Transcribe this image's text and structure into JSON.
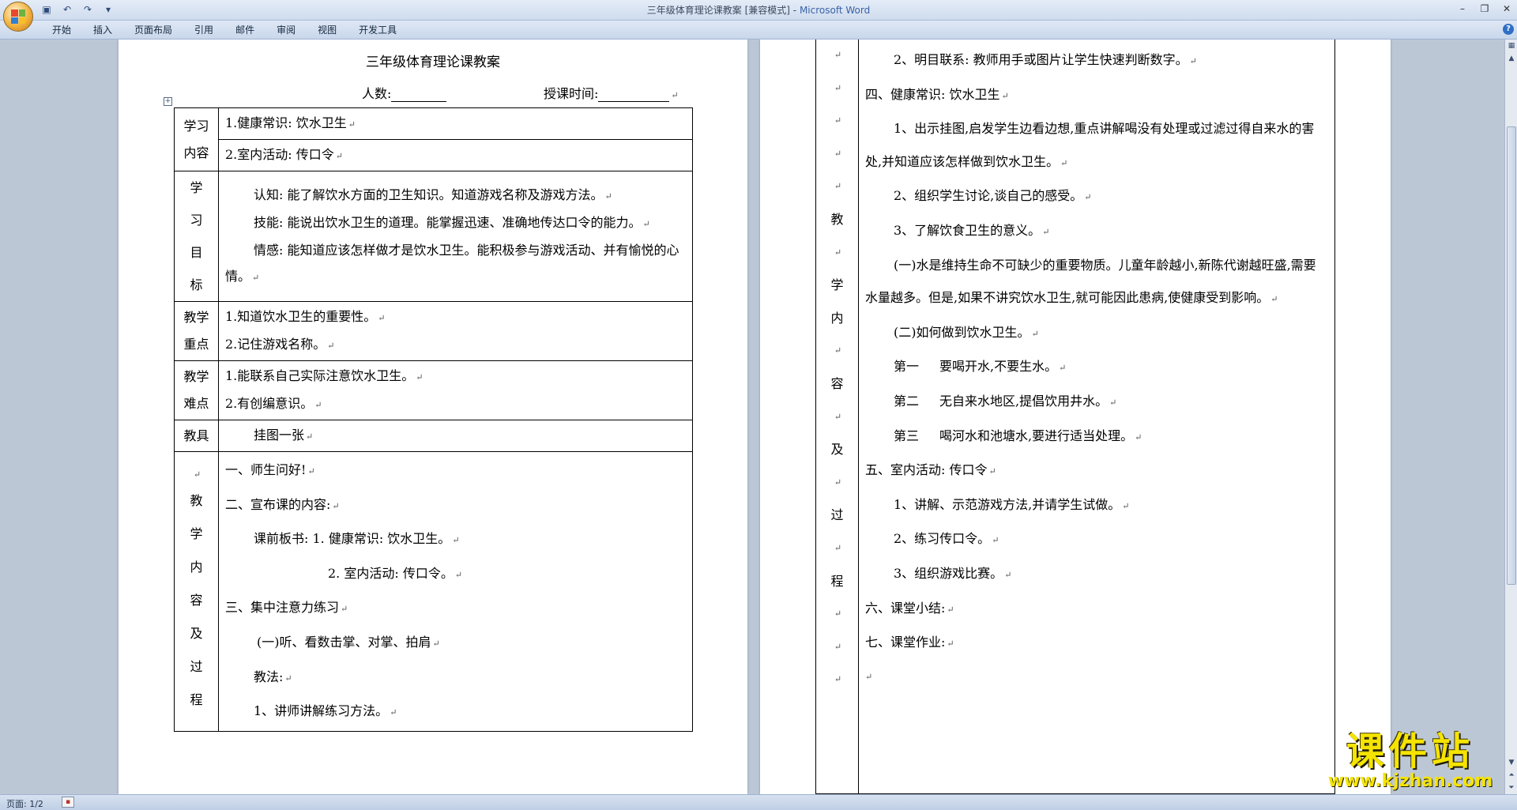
{
  "window": {
    "title": "三年级体育理论课教案 [兼容模式]",
    "app_name": "Microsoft Word"
  },
  "quick_access": [
    "save-icon",
    "undo-icon",
    "redo-icon",
    "customize-icon"
  ],
  "ribbon": {
    "tabs": [
      "开始",
      "插入",
      "页面布局",
      "引用",
      "邮件",
      "审阅",
      "视图",
      "开发工具"
    ]
  },
  "status": {
    "page": "页面: 1/2"
  },
  "watermark": {
    "text": "课件站",
    "url": "www.kjzhan.com"
  },
  "colors": {
    "accent": "#3a62a8",
    "watermark": "#f5e400"
  },
  "page1": {
    "title": "三年级体育理论课教案",
    "people_label": "人数:",
    "time_label": "授课时间:",
    "rows": {
      "content_head": "学习\n内容",
      "content_1": "1.健康常识: 饮水卫生",
      "content_2": "2.室内活动: 传口令",
      "goal_head": [
        "学",
        "习",
        "目",
        "标"
      ],
      "goal_1": "认知: 能了解饮水方面的卫生知识。知道游戏名称及游戏方法。",
      "goal_2": "技能: 能说出饮水卫生的道理。能掌握迅速、准确地传达口令的能力。",
      "goal_3": "情感: 能知道应该怎样做才是饮水卫生。能积极参与游戏活动、并有愉悦的心情。",
      "key_head": "教学\n重点",
      "key_1": "1.知道饮水卫生的重要性。",
      "key_2": "2.记住游戏名称。",
      "diff_head": "教学\n难点",
      "diff_1": "1.能联系自己实际注意饮水卫生。",
      "diff_2": "2.有创编意识。",
      "tool_head": "教具",
      "tool_1": "挂图一张",
      "proc_head": [
        "教",
        "学",
        "内",
        "容",
        "及",
        "过",
        "程"
      ],
      "proc": [
        "一、师生问好!",
        "二、宣布课的内容:",
        "课前板书: 1. 健康常识: 饮水卫生。",
        "2. 室内活动: 传口令。",
        "三、集中注意力练习",
        "(一)听、看数击掌、对掌、拍肩",
        "教法:",
        "1、讲师讲解练习方法。"
      ]
    }
  },
  "page2": {
    "head_chars": [
      "教",
      "学",
      "内",
      "容",
      "及",
      "过",
      "程"
    ],
    "lines": [
      "2、明目联系: 教师用手或图片让学生快速判断数字。",
      "四、健康常识: 饮水卫生",
      "1、出示挂图,启发学生边看边想,重点讲解喝没有处理或过滤过得自来水的害处,并知道应该怎样做到饮水卫生。",
      "2、组织学生讨论,谈自己的感受。",
      "3、了解饮食卫生的意义。",
      "(一)水是维持生命不可缺少的重要物质。儿童年龄越小,新陈代谢越旺盛,需要水量越多。但是,如果不讲究饮水卫生,就可能因此患病,使健康受到影响。",
      "(二)如何做到饮水卫生。",
      "第一",
      "要喝开水,不要生水。",
      "第二",
      "无自来水地区,提倡饮用井水。",
      "第三",
      "喝河水和池塘水,要进行适当处理。",
      "五、室内活动: 传口令",
      "1、讲解、示范游戏方法,并请学生试做。",
      "2、练习传口令。",
      "3、组织游戏比赛。",
      "六、课堂小结:",
      "七、课堂作业:"
    ]
  }
}
